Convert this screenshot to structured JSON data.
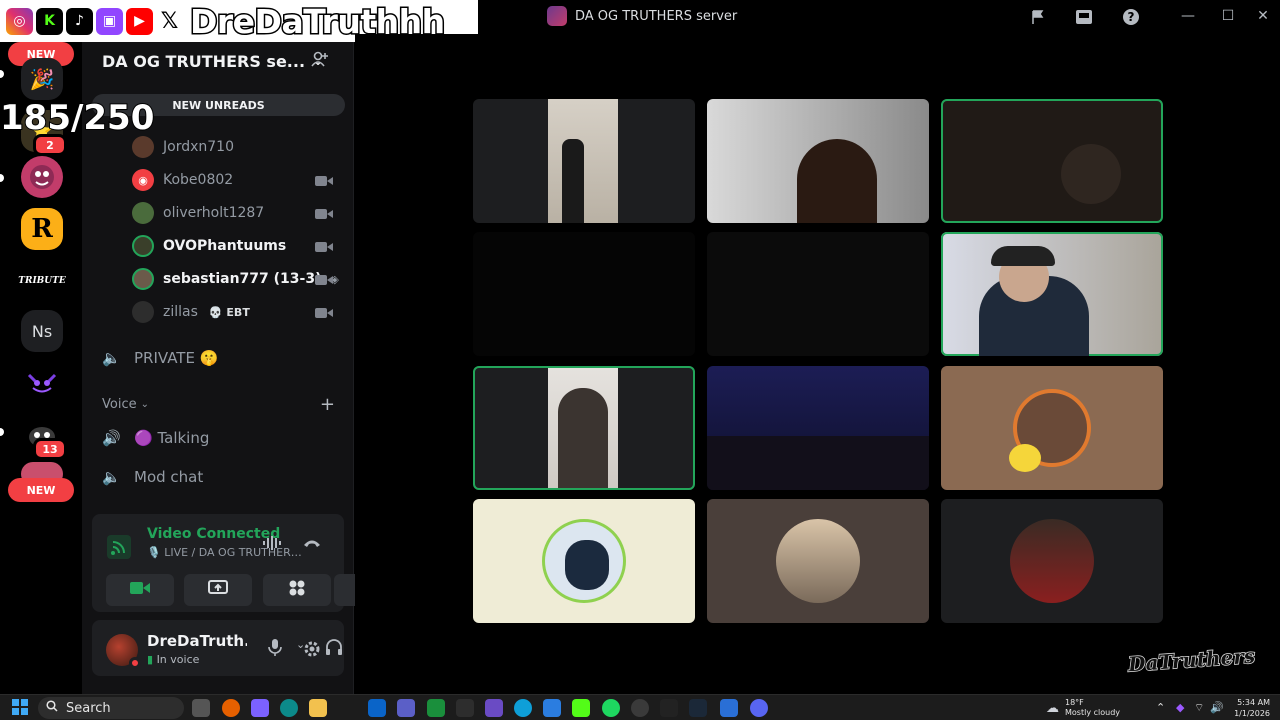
{
  "window": {
    "title": "DA OG TRUTHERS server",
    "icons": [
      "flag-icon",
      "inbox-icon",
      "help-icon"
    ],
    "controls": [
      "minimize-icon",
      "maximize-icon",
      "close-icon"
    ]
  },
  "overlay": {
    "streamer_name": "DreDaTruthhh",
    "socials": [
      "instagram-icon",
      "kick-icon",
      "tiktok-icon",
      "twitch-icon",
      "youtube-icon",
      "x-icon"
    ],
    "counter": "185/250",
    "watermark": "DaTruthers"
  },
  "rail": {
    "new_label_top": "NEW",
    "new_label_bottom": "NEW",
    "badges": {
      "server_2": "2",
      "server_8": "13"
    },
    "ns_label": "Ns",
    "tribute_label": "TRIBUTE",
    "rockstar_label": "R"
  },
  "server": {
    "name": "DA OG TRUTHERS se...",
    "new_unreads": "NEW UNREADS",
    "members": [
      {
        "name": "Jordxn710"
      },
      {
        "name": "Kobe0802"
      },
      {
        "name": "oliverholt1287"
      },
      {
        "name": "OVOPhantuums"
      },
      {
        "name": "sebastian777 (13-3)"
      },
      {
        "name": "zillas",
        "tag": "💀 EBT"
      }
    ],
    "private_channel": "PRIVATE 🤫",
    "voice_category": "Voice",
    "voice_channels": [
      "🟣 Talking",
      "Mod chat"
    ]
  },
  "voice_panel": {
    "status": "Video Connected",
    "subtitle": "🎙️ LIVE / DA OG TRUTHERS ser..."
  },
  "user_panel": {
    "username": "DreDaTruth...",
    "status": "In voice"
  },
  "taskbar": {
    "search_label": "Search",
    "weather_temp": "18°F",
    "weather_desc": "Mostly cloudy",
    "time": "5:34 AM",
    "date": "1/1/2026"
  }
}
